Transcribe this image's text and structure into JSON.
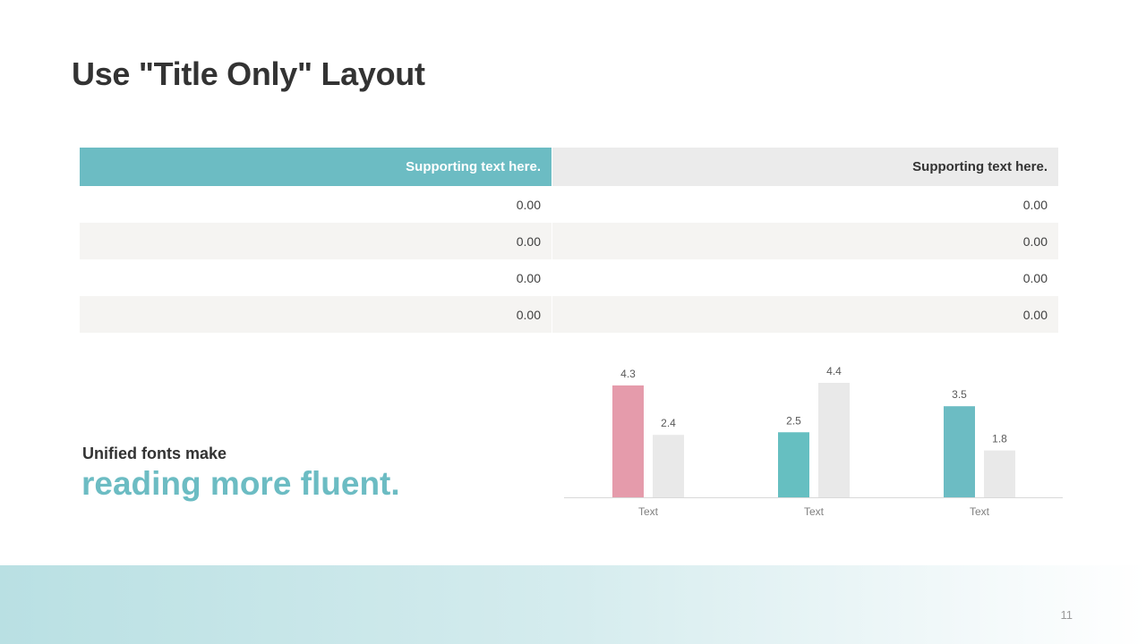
{
  "slide": {
    "title": "Use \"Title Only\" Layout",
    "page_number": "11"
  },
  "table": {
    "header": [
      "Supporting text here.",
      "Supporting text here."
    ],
    "rows": [
      [
        "0.00",
        "0.00"
      ],
      [
        "0.00",
        "0.00"
      ],
      [
        "0.00",
        "0.00"
      ],
      [
        "0.00",
        "0.00"
      ]
    ]
  },
  "caption": {
    "line1": "Unified fonts make",
    "line2": "reading more fluent."
  },
  "colors": {
    "accent_teal": "#6cbcc3",
    "accent_pink": "#e59bab",
    "neutral_gray": "#e9e9e9"
  },
  "chart_data": {
    "type": "bar",
    "categories": [
      "Text",
      "Text",
      "Text"
    ],
    "series": [
      {
        "values": [
          4.3,
          2.5,
          3.5
        ],
        "colors": [
          "#e59bab",
          "#66bfc1",
          "#6cbcc3"
        ]
      },
      {
        "values": [
          2.4,
          4.4,
          1.8
        ],
        "colors": [
          "#e9e9e9",
          "#e9e9e9",
          "#e9e9e9"
        ]
      }
    ],
    "data_labels": true,
    "ylim": [
      0,
      4.4
    ],
    "grid": false
  }
}
